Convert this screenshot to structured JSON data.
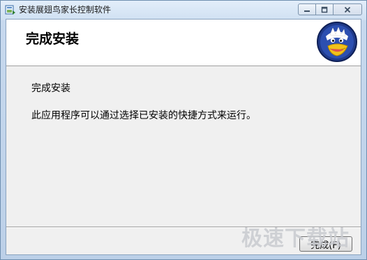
{
  "window": {
    "title": "安装展翅鸟家长控制软件",
    "icon": "installer-app-icon"
  },
  "caption_buttons": {
    "minimize": "—",
    "maximize": "▢",
    "close": "✕"
  },
  "header": {
    "title": "完成安装",
    "logo": "eagle-mascot-logo"
  },
  "content": {
    "line1": "完成安装",
    "line2": "此应用程序可以通过选择已安装的快捷方式来运行。"
  },
  "footer": {
    "finish_label": "完成(F)"
  },
  "watermark": "极速下载站",
  "colors": {
    "titlebar": "#dbe8f5",
    "client_bg": "#f0f0f0",
    "header_bg": "#ffffff",
    "logo_blue": "#1f3a8a",
    "logo_yellow": "#f2c21a"
  }
}
